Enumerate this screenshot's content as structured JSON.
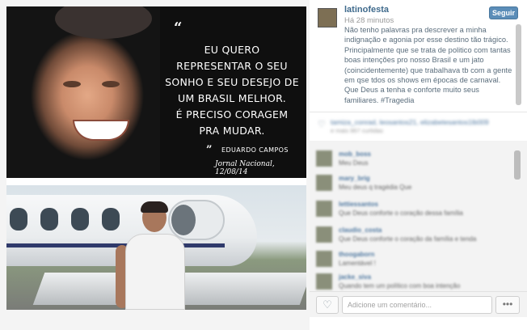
{
  "post": {
    "quote_lines": [
      "EU QUERO",
      "REPRESENTAR O SEU",
      "SONHO E SEU DESEJO DE",
      "UM BRASIL MELHOR.",
      "É PRECISO CORAGEM",
      "PRA MUDAR."
    ],
    "quote_open": "“",
    "author_mark": "”",
    "author": "EDUARDO CAMPOS",
    "source": "Jornal Nacional, 12/08/14"
  },
  "side": {
    "username": "latinofesta",
    "time": "Há 28 minutos",
    "follow_label": "Seguir",
    "caption": "Não tenho palavras pra descrever a minha indignação e agonia por esse destino tão trágico. Principalmente que se trata de politico com tantas boas intenções pro nosso Brasil e um jato (coincidentemente) que trabalhava tb com a gente em qse tdos os shows em épocas de carnaval. Que Deus a tenha e conforte muito seus familiares. #Tragedia",
    "likes_text": "tamiza_conrad, leosantos21, elizabetesantos1lb009",
    "likes_sub": "e mais 967 curtidas",
    "comments": [
      {
        "user": "mob_boss",
        "text": "Meu Deus"
      },
      {
        "user": "mary_brig",
        "text": "Meu deus q tragédia Que"
      },
      {
        "user": "lettiessantos",
        "text": "Que Deus conforte o coração dessa família"
      },
      {
        "user": "claudio_costa",
        "text": "Que Deus conforte o coração da família e tenda"
      },
      {
        "user": "thoogaborn",
        "text": "Lamentável !"
      },
      {
        "user": "jacke_siva",
        "text": "Quando tem um político com boa intenção"
      }
    ],
    "comment_placeholder": "Adicione um comentário...",
    "more_label": "•••",
    "heart_icon": "♡"
  }
}
